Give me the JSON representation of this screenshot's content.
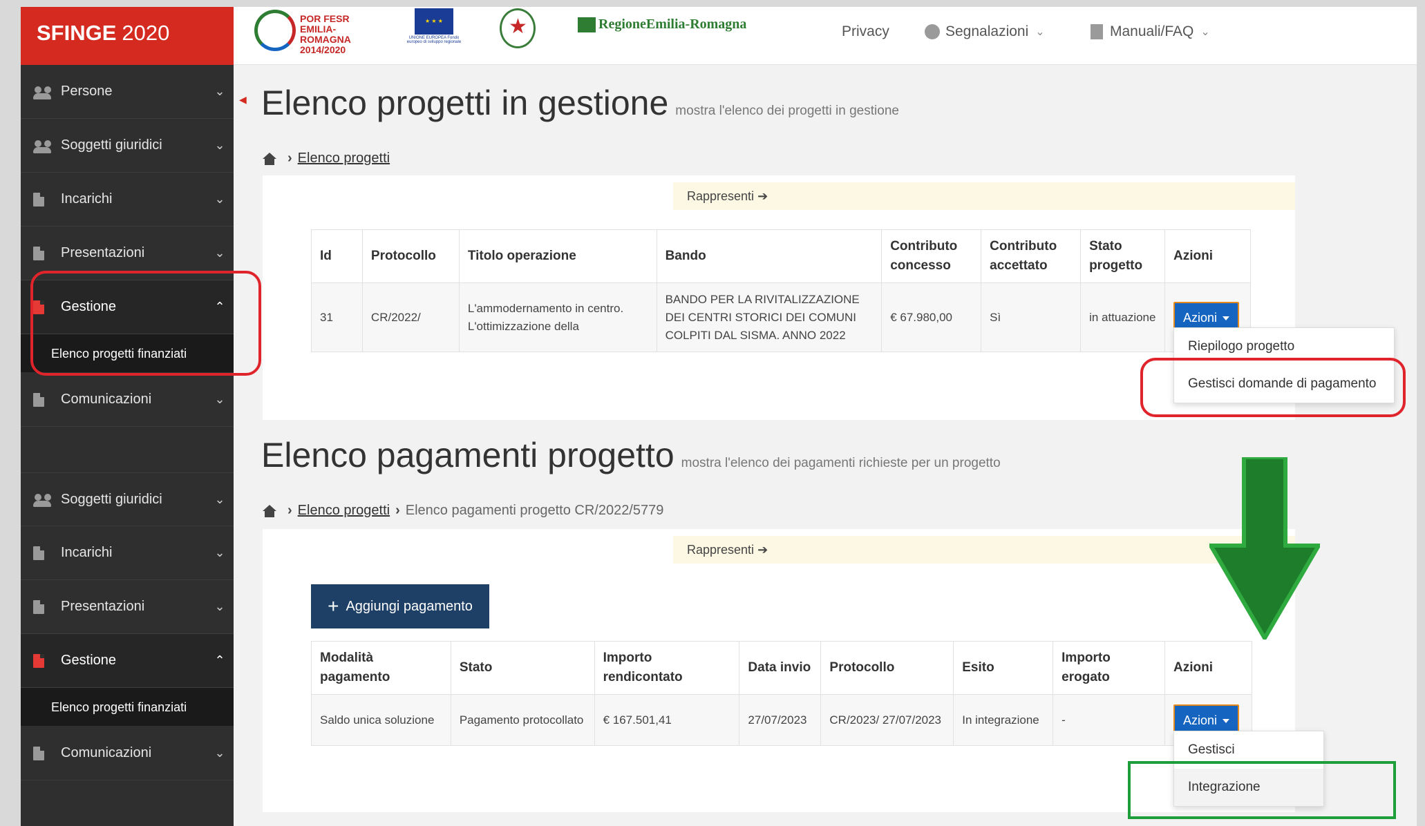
{
  "brand": {
    "name": "SFINGE",
    "year": "2020"
  },
  "logos": {
    "por": "POR FESR EMILIA-ROMAGNA 2014/2020",
    "eu_caption": "UNIONE EUROPEA Fondo europeo di sviluppo regionale",
    "regione": "RegioneEmilia-Romagna"
  },
  "topnav": {
    "privacy": "Privacy",
    "segnalazioni": "Segnalazioni",
    "manuali": "Manuali/FAQ"
  },
  "sidebar_top": [
    {
      "label": "Persone",
      "icon": "people-icon"
    },
    {
      "label": "Soggetti giuridici",
      "icon": "people-icon"
    },
    {
      "label": "Incarichi",
      "icon": "document-icon"
    },
    {
      "label": "Presentazioni",
      "icon": "document-icon"
    },
    {
      "label": "Gestione",
      "icon": "document-icon"
    },
    {
      "label": "Comunicazioni",
      "icon": "document-icon"
    }
  ],
  "sidebar_top_sub": "Elenco progetti finanziati",
  "sidebar_bottom": [
    {
      "label": "Soggetti giuridici",
      "icon": "people-icon"
    },
    {
      "label": "Incarichi",
      "icon": "document-icon"
    },
    {
      "label": "Presentazioni",
      "icon": "document-icon"
    },
    {
      "label": "Gestione",
      "icon": "document-icon"
    },
    {
      "label": "Comunicazioni",
      "icon": "document-icon"
    }
  ],
  "sidebar_bottom_sub": "Elenco progetti finanziati",
  "section1": {
    "title": "Elenco progetti in gestione",
    "subtitle": "mostra l'elenco dei progetti in gestione",
    "breadcrumb": [
      "Elenco progetti"
    ],
    "rappresenti": "Rappresenti",
    "headers": [
      "Id",
      "Protocollo",
      "Titolo operazione",
      "Bando",
      "Contributo concesso",
      "Contributo accettato",
      "Stato progetto",
      "Azioni"
    ],
    "row": {
      "id": "31",
      "protocollo": "CR/2022/",
      "titolo": "L'ammodernamento in centro. L'ottimizzazione della",
      "bando": "BANDO PER LA RIVITALIZZAZIONE DEI CENTRI STORICI DEI COMUNI COLPITI DAL SISMA. ANNO 2022",
      "concesso": "€ 67.980,00",
      "accettato": "Sì",
      "stato": "in attuazione",
      "azioni": "Azioni"
    },
    "menu": [
      "Riepilogo progetto",
      "Gestisci domande di pagamento"
    ]
  },
  "section2": {
    "title": "Elenco pagamenti progetto",
    "subtitle": "mostra l'elenco dei pagamenti richieste per un progetto",
    "breadcrumb_link": "Elenco progetti",
    "breadcrumb_current": "Elenco pagamenti progetto CR/2022/5779",
    "rappresenti": "Rappresenti",
    "add_button": "Aggiungi pagamento",
    "headers": [
      "Modalità pagamento",
      "Stato",
      "Importo rendicontato",
      "Data invio",
      "Protocollo",
      "Esito",
      "Importo erogato",
      "Azioni"
    ],
    "row": {
      "modalita": "Saldo unica soluzione",
      "stato": "Pagamento protocollato",
      "importo": "€ 167.501,41",
      "data": "27/07/2023",
      "protocollo": "CR/2023/ 27/07/2023",
      "esito": "In integrazione",
      "erogato": "-",
      "azioni": "Azioni"
    },
    "menu": [
      "Gestisci",
      "Integrazione"
    ]
  },
  "colors": {
    "brand_red": "#d42a1f",
    "sidebar": "#2f2f2f",
    "primary": "#1565c0",
    "add_button": "#1e3f66",
    "highlight_red": "#e0242b",
    "highlight_green": "#1e9e3a"
  }
}
